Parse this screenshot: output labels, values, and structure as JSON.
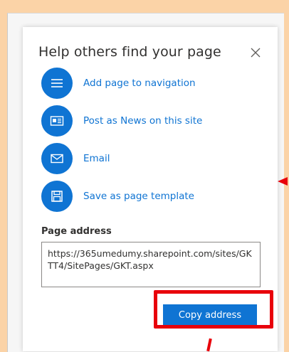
{
  "panel": {
    "title": "Help others find your page",
    "actions": [
      {
        "label": "Add page to navigation",
        "icon": "menu-icon"
      },
      {
        "label": "Post as News on this site",
        "icon": "news-icon"
      },
      {
        "label": "Email",
        "icon": "mail-icon"
      },
      {
        "label": "Save as page template",
        "icon": "save-icon"
      }
    ],
    "address_label": "Page address",
    "address_value": "https://365umedumy.sharepoint.com/sites/GKTT4/SitePages/GKT.aspx",
    "copy_label": "Copy address"
  },
  "colors": {
    "accent": "#0f74d3",
    "annotation": "#e8000b",
    "background": "#fbd3a7"
  }
}
